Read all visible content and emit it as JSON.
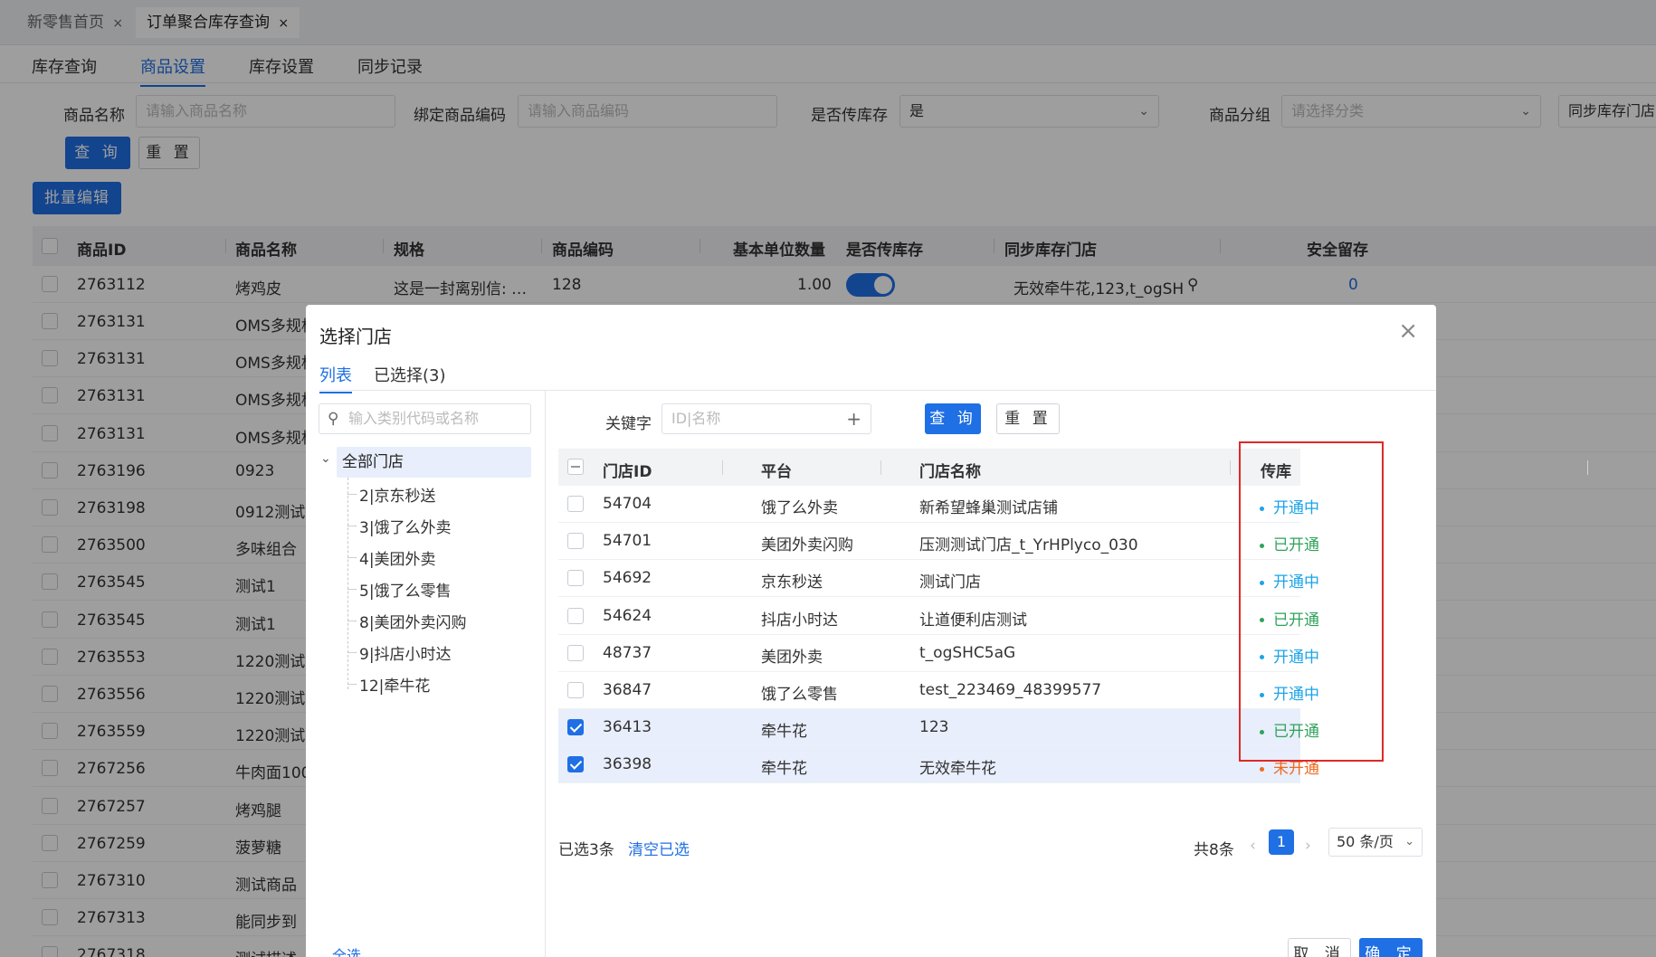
{
  "page_tabs": [
    {
      "label": "新零售首页",
      "close": "×"
    },
    {
      "label": "订单聚合库存查询",
      "close": "×"
    }
  ],
  "sub_nav": [
    "库存查询",
    "商品设置",
    "库存设置",
    "同步记录"
  ],
  "filters": {
    "name_label": "商品名称",
    "name_placeholder": "请输入商品名称",
    "code_label": "绑定商品编码",
    "code_placeholder": "请输入商品编码",
    "sync_label": "是否传库存",
    "sync_value": "是",
    "group_label": "商品分组",
    "group_placeholder": "请选择分类",
    "store_label": "同步库存门店",
    "query_btn": "查 询",
    "reset_btn": "重 置",
    "batch_btn": "批量编辑"
  },
  "grid": {
    "headers": [
      "商品ID",
      "商品名称",
      "规格",
      "商品编码",
      "基本单位数量",
      "是否传库存",
      "同步库存门店",
      "安全留存"
    ],
    "first_row": {
      "id": "2763112",
      "name": "烤鸡皮",
      "spec": "这是一封离别信: …",
      "code": "128",
      "qty": "1.00",
      "stores": "无效牵牛花,123,t_ogSH",
      "safe": "0"
    },
    "rows": [
      {
        "id": "2763131",
        "name": "OMS多规格"
      },
      {
        "id": "2763131",
        "name": "OMS多规格"
      },
      {
        "id": "2763131",
        "name": "OMS多规格"
      },
      {
        "id": "2763131",
        "name": "OMS多规格"
      },
      {
        "id": "2763196",
        "name": "0923"
      },
      {
        "id": "2763198",
        "name": "0912测试"
      },
      {
        "id": "2763500",
        "name": "多味组合"
      },
      {
        "id": "2763545",
        "name": "测试1"
      },
      {
        "id": "2763545",
        "name": "测试1"
      },
      {
        "id": "2763553",
        "name": "1220测试"
      },
      {
        "id": "2763556",
        "name": "1220测试"
      },
      {
        "id": "2763559",
        "name": "1220测试"
      },
      {
        "id": "2767256",
        "name": "牛肉面100"
      },
      {
        "id": "2767257",
        "name": "烤鸡腿"
      },
      {
        "id": "2767259",
        "name": "菠萝糖"
      },
      {
        "id": "2767310",
        "name": "测试商品"
      },
      {
        "id": "2767313",
        "name": "能同步到"
      },
      {
        "id": "2767318",
        "name": "测试描述"
      }
    ]
  },
  "modal": {
    "title": "选择门店",
    "close": "×",
    "tabs": [
      "列表",
      "已选择(3)"
    ],
    "tree": {
      "search_placeholder": "输入类别代码或名称",
      "root": "全部门店",
      "items": [
        "2|京东秒送",
        "3|饿了么外卖",
        "4|美团外卖",
        "5|饿了么零售",
        "8|美团外卖闪购",
        "9|抖店小时达",
        "12|牵牛花"
      ]
    },
    "keyword_label": "关键字",
    "keyword_placeholder": "ID|名称",
    "query_btn": "查 询",
    "reset_btn": "重 置",
    "table": {
      "headers": [
        "门店ID",
        "平台",
        "门店名称",
        "传库存开通状态"
      ],
      "rows": [
        {
          "id": "54704",
          "platform": "饿了么外卖",
          "name": "新希望蜂巢测试店铺",
          "status": "开通中",
          "status_type": "open",
          "checked": false
        },
        {
          "id": "54701",
          "platform": "美团外卖闪购",
          "name": "压测测试门店_t_YrHPlyco_030",
          "status": "已开通",
          "status_type": "done",
          "checked": false
        },
        {
          "id": "54692",
          "platform": "京东秒送",
          "name": "测试门店",
          "status": "开通中",
          "status_type": "open",
          "checked": false
        },
        {
          "id": "54624",
          "platform": "抖店小时达",
          "name": "让道便利店测试",
          "status": "已开通",
          "status_type": "done",
          "checked": false
        },
        {
          "id": "48737",
          "platform": "美团外卖",
          "name": "t_ogSHC5aG",
          "status": "开通中",
          "status_type": "open",
          "checked": false
        },
        {
          "id": "36847",
          "platform": "饿了么零售",
          "name": "test_223469_48399577",
          "status": "开通中",
          "status_type": "open",
          "checked": false
        },
        {
          "id": "36413",
          "platform": "牵牛花",
          "name": "123",
          "status": "已开通",
          "status_type": "done",
          "checked": true
        },
        {
          "id": "36398",
          "platform": "牵牛花",
          "name": "无效牵牛花",
          "status": "未开通",
          "status_type": "none",
          "checked": true
        }
      ]
    },
    "selected_count": "已选3条",
    "clear_selected": "清空已选",
    "total": "共8条",
    "page": "1",
    "page_size": "50 条/页",
    "select_all": "全选",
    "cancel_btn": "取 消",
    "ok_btn": "确 定"
  },
  "colors": {
    "primary": "#1f6fe5",
    "status_open": "#1aa4e8",
    "status_done": "#2ea35a",
    "status_none": "#f06a1e",
    "highlight_box": "#e02828"
  }
}
